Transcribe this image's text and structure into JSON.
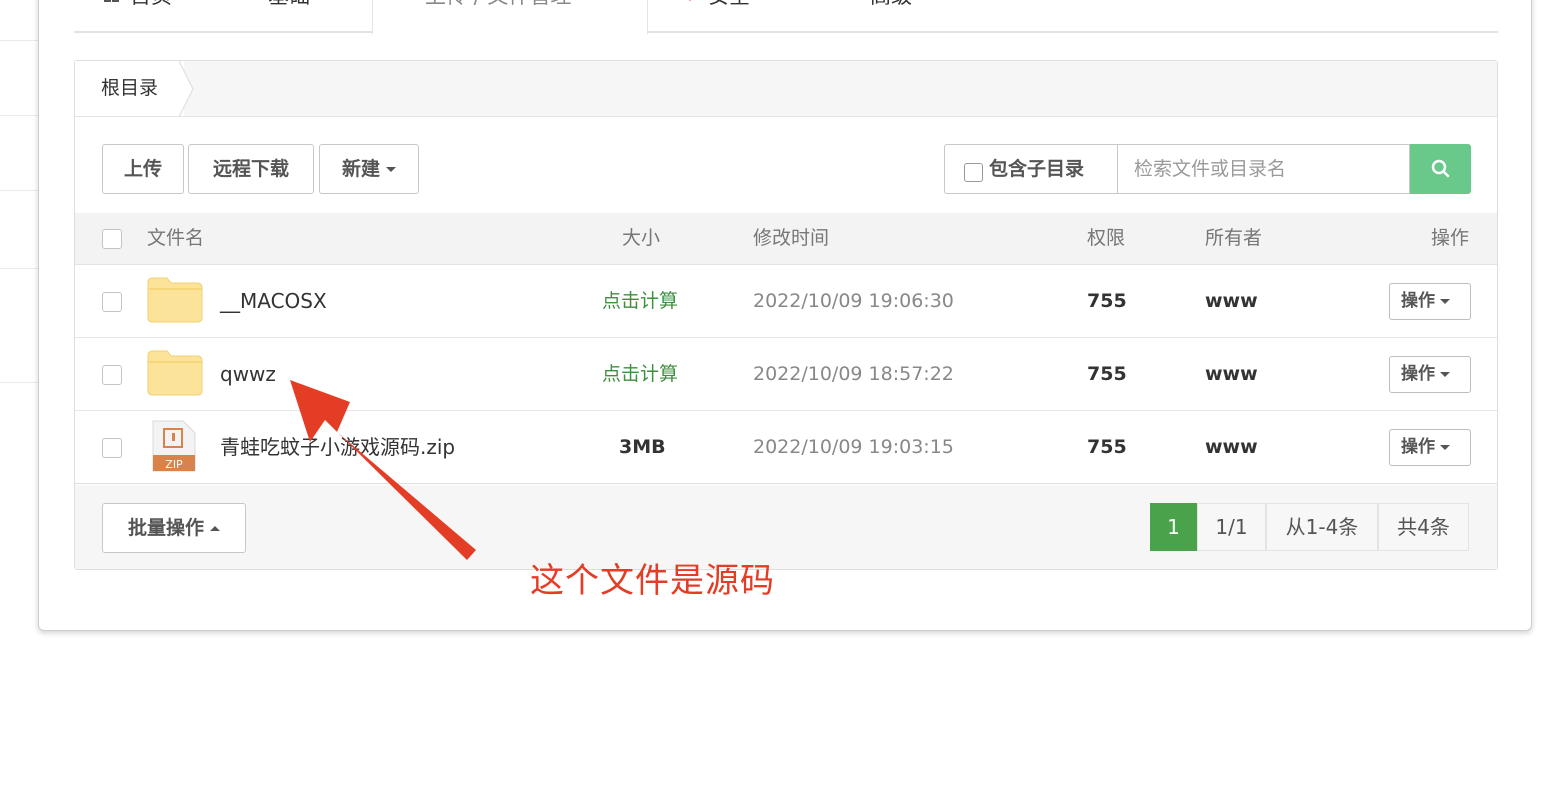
{
  "tabs": [
    {
      "label": "首页"
    },
    {
      "label": "基础"
    },
    {
      "label": "上传 / 文件管理"
    },
    {
      "label": "安全"
    },
    {
      "label": "高级"
    }
  ],
  "breadcrumb": {
    "root": "根目录"
  },
  "toolbar": {
    "upload": "上传",
    "remote_download": "远程下载",
    "new": "新建",
    "include_subdir": "包含子目录",
    "search_placeholder": "检索文件或目录名"
  },
  "table": {
    "headers": {
      "name": "文件名",
      "size": "大小",
      "mtime": "修改时间",
      "perm": "权限",
      "owner": "所有者",
      "op": "操作"
    },
    "rows": [
      {
        "name": "__MACOSX",
        "size": "点击计算",
        "mtime": "2022/10/09 19:06:30",
        "perm": "755",
        "owner": "www",
        "op": "操作",
        "type": "folder"
      },
      {
        "name": "qwwz",
        "size": "点击计算",
        "mtime": "2022/10/09 18:57:22",
        "perm": "755",
        "owner": "www",
        "op": "操作",
        "type": "folder"
      },
      {
        "name": "青蛙吃蚊子小游戏源码.zip",
        "size": "3MB",
        "mtime": "2022/10/09 19:03:15",
        "perm": "755",
        "owner": "www",
        "op": "操作",
        "type": "zip",
        "icon_text": "ZIP"
      }
    ]
  },
  "footer": {
    "batch": "批量操作",
    "pager": {
      "current": "1",
      "pages": "1/1",
      "range": "从1-4条",
      "total": "共4条"
    }
  },
  "annotation": {
    "text": "这个文件是源码"
  },
  "colors": {
    "accent_green": "#4aa34a",
    "search_green": "#68c98a",
    "annotation_red": "#e43d26",
    "folder_yellow": "#fbe49a"
  }
}
